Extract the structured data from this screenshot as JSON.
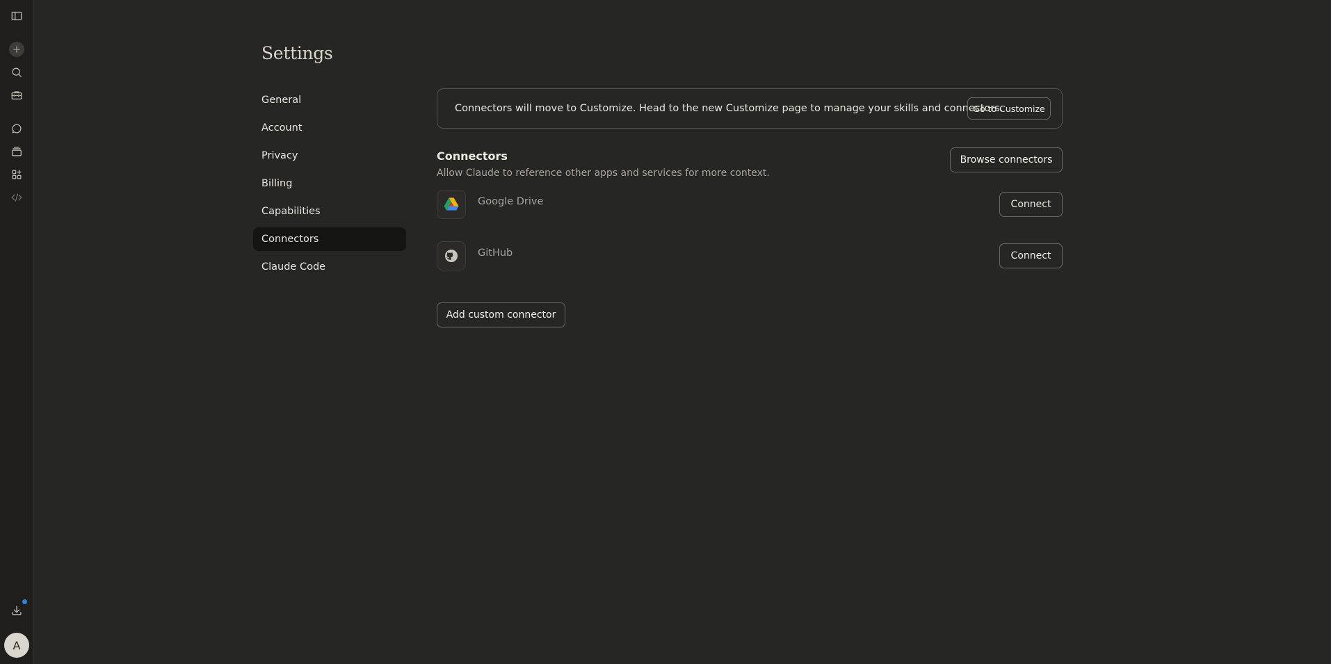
{
  "rail": {
    "icons": [
      "sidebar-toggle-icon",
      "plus-icon",
      "search-icon",
      "toolbox-icon",
      "chat-icon",
      "archive-icon",
      "apps-icon",
      "code-icon",
      "download-icon"
    ],
    "avatar_letter": "A",
    "notification_color": "#2c84db"
  },
  "page": {
    "title": "Settings"
  },
  "nav": {
    "items": [
      {
        "label": "General"
      },
      {
        "label": "Account"
      },
      {
        "label": "Privacy"
      },
      {
        "label": "Billing"
      },
      {
        "label": "Capabilities"
      },
      {
        "label": "Connectors",
        "active": true
      },
      {
        "label": "Claude Code"
      }
    ]
  },
  "banner": {
    "text": "Connectors will move to Customize. Head to the new Customize page to manage your skills and connectors.",
    "button_label": "Go to Customize"
  },
  "connectors": {
    "title": "Connectors",
    "description": "Allow Claude to reference other apps and services for more context.",
    "browse_label": "Browse connectors",
    "items": [
      {
        "name": "Google Drive",
        "icon": "google-drive-icon",
        "button_label": "Connect"
      },
      {
        "name": "GitHub",
        "icon": "github-icon",
        "button_label": "Connect"
      }
    ],
    "add_custom_label": "Add custom connector"
  },
  "colors": {
    "background": "#262624",
    "rail": "#1f1e1d",
    "active_nav": "#141413",
    "text": "#e8e6dc",
    "muted_text": "#a6a49a"
  }
}
